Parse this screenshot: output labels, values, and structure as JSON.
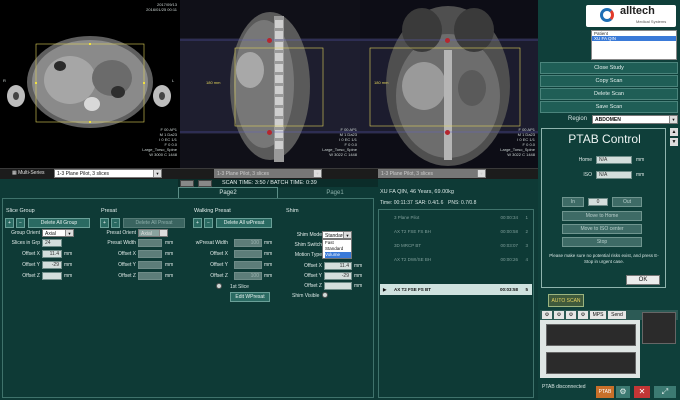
{
  "viewers": {
    "left": {
      "date": "2017/09/13",
      "time": "2016/01/25 00:11",
      "top_left_info": [
        "",
        ""
      ],
      "side_labels": [
        "R",
        "L"
      ],
      "info_bottom": [
        "F 00 AP1",
        "M 1 Da23",
        "I 0 EC 1/1",
        "F 0 0.0",
        "Large_Torso_Spine",
        "W 3000 C 1448"
      ]
    },
    "center": {
      "date": "2017/09/13",
      "time": "2016/01/25 11:48",
      "bottom_right": [
        "F 00 AP1",
        "M 1 Da23",
        "I 0 EC 1/1",
        "F 0 0.0",
        "Large_Torso_Spine",
        "W 3022 C 1448"
      ],
      "ruler": "180 mm"
    },
    "right": {
      "date": "2017/09/13",
      "time": "2016/01/25 11:48",
      "bottom_right": [
        "F 00 AP1",
        "M 1 Da23",
        "I 0 EC 1/1",
        "F 0 0.0",
        "Large_Torso_Spine",
        "W 3022 C 1448"
      ],
      "ruler": "180 mm"
    }
  },
  "series_bar": {
    "multi_series": "Multi-Series",
    "left_select": "1-3 Plane Pilot, 3 slices",
    "center_select": "1-3 Plane Pilot, 3 slices",
    "right_select": "1-3 Plane Pilot, 3 slices",
    "scan_time": "SCAN TIME: 3:50 / BATCH TIME: 0:39"
  },
  "tabs": {
    "page2": "Page2",
    "page1": "Page1"
  },
  "slice_group": {
    "title": "Slice Group",
    "delete_all": "Delete All Group",
    "group_orient_label": "Group Orient",
    "group_orient": "Axial",
    "slices_label": "Slices in Grp",
    "slices": "24",
    "offset_x_label": "Offset X",
    "offset_x": "11.4",
    "offset_y_label": "Offset Y",
    "offset_y": "-29",
    "offset_z_label": "Offset Z",
    "offset_z": "",
    "unit": "mm"
  },
  "presat": {
    "title": "Presat",
    "delete_all": "Delete All Presat",
    "orient_label": "Presat Orient",
    "orient": "Axial",
    "width_label": "Presat Width",
    "width": "",
    "offset_x_label": "Offset X",
    "offset_y_label": "Offset Y",
    "offset_z_label": "Offset Z",
    "unit": "mm"
  },
  "walking_presat": {
    "title": "Walking Presat",
    "delete_all": "Delete All wPresat",
    "width_label": "wPresat Width",
    "width": "100",
    "offset_x_label": "Offset X",
    "offset_y_label": "Offset Y",
    "offset_z_label": "Offset Z",
    "offset_z": "100",
    "first_slice": "1st Slice",
    "edit": "Edit WPresat",
    "unit": "mm"
  },
  "shim": {
    "title": "Shim",
    "mode_label": "Shim Mode",
    "mode": "Standard",
    "options": [
      "Fast",
      "Standard",
      "Volume"
    ],
    "switch_label": "Shim Switch",
    "motion_label": "Motion Type",
    "offset_x_label": "Offset X",
    "offset_x": "11.4",
    "offset_y_label": "Offset Y",
    "offset_y": "-29",
    "offset_z_label": "Offset Z",
    "visible_label": "Shim Visible",
    "unit": "mm"
  },
  "patient": {
    "header": "XU FA QIN, 46 Years, 69.00kg",
    "time": "Time: 00:11:37",
    "sar": "SAR: 0.4/1.6",
    "pns": "PNS: 0.7/0.8"
  },
  "protocols": [
    {
      "name": "3 Plane Pilot",
      "time": "00:00:34",
      "index": "1",
      "active": false
    },
    {
      "name": "AX T2 FSE FS BH",
      "time": "00:00:58",
      "index": "2",
      "active": false
    },
    {
      "name": "3D MRCP BT",
      "time": "00:03:07",
      "index": "3",
      "active": false
    },
    {
      "name": "AX T2 DWI/SE BH",
      "time": "00:00:26",
      "index": "4",
      "active": false
    },
    {
      "name": "AX T2 FSE FS BT",
      "time": "00:03:58",
      "index": "5",
      "active": true
    }
  ],
  "sidebar": {
    "logo": "alltech",
    "logo_sub": "Medical Systems",
    "patient_label": "Patient",
    "patient_name": "XU FA QIN",
    "close_study": "Close Study",
    "copy_scan": "Copy Scan",
    "delete_scan": "Delete Scan",
    "save_scan": "Save Scan",
    "region_label": "Region",
    "region": "ABDOMEN"
  },
  "ptab": {
    "title": "PTAB Control",
    "home_label": "Home",
    "home_value": "N/A",
    "iso_label": "ISO",
    "iso_value": "N/A",
    "unit": "mm",
    "in": "In",
    "value": "0",
    "out": "Out",
    "move_home": "Move to Home",
    "move_iso": "Move to ISO center",
    "stop": "Stop",
    "note": "Please make sure no potential risks exist, and press E-Stop in urgent case.",
    "ok": "OK"
  },
  "bottom_right": {
    "auto_scan": "AUTO SCAN",
    "mps": "MPS",
    "send": "Send",
    "status": "PTAB disconnected",
    "ptab_btn": "PTAB"
  },
  "colors": {
    "accent_green": "#1f5e56",
    "slab_yellow": "#e0d25a",
    "active_row": "#cfe2df"
  }
}
